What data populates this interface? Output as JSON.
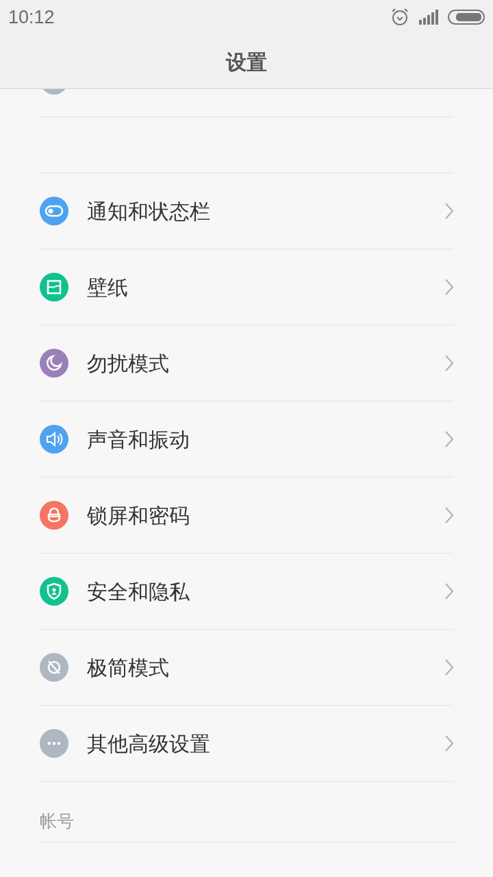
{
  "status_bar": {
    "time": "10:12"
  },
  "header": {
    "title": "设置"
  },
  "items": [
    {
      "kind": "toggle",
      "label": "通知和状态栏",
      "color": "#4ea3f1"
    },
    {
      "kind": "wallpaper",
      "label": "壁纸",
      "color": "#10c28f"
    },
    {
      "kind": "moon",
      "label": "勿扰模式",
      "color": "#9a80b9"
    },
    {
      "kind": "sound",
      "label": "声音和振动",
      "color": "#4ea3f1"
    },
    {
      "kind": "lock",
      "label": "锁屏和密码",
      "color": "#f57462"
    },
    {
      "kind": "shield",
      "label": "安全和隐私",
      "color": "#10c28f"
    },
    {
      "kind": "simple",
      "label": "极简模式",
      "color": "#adb8c3"
    },
    {
      "kind": "more",
      "label": "其他高级设置",
      "color": "#adb8c3"
    }
  ],
  "section": {
    "title": "帐号"
  }
}
